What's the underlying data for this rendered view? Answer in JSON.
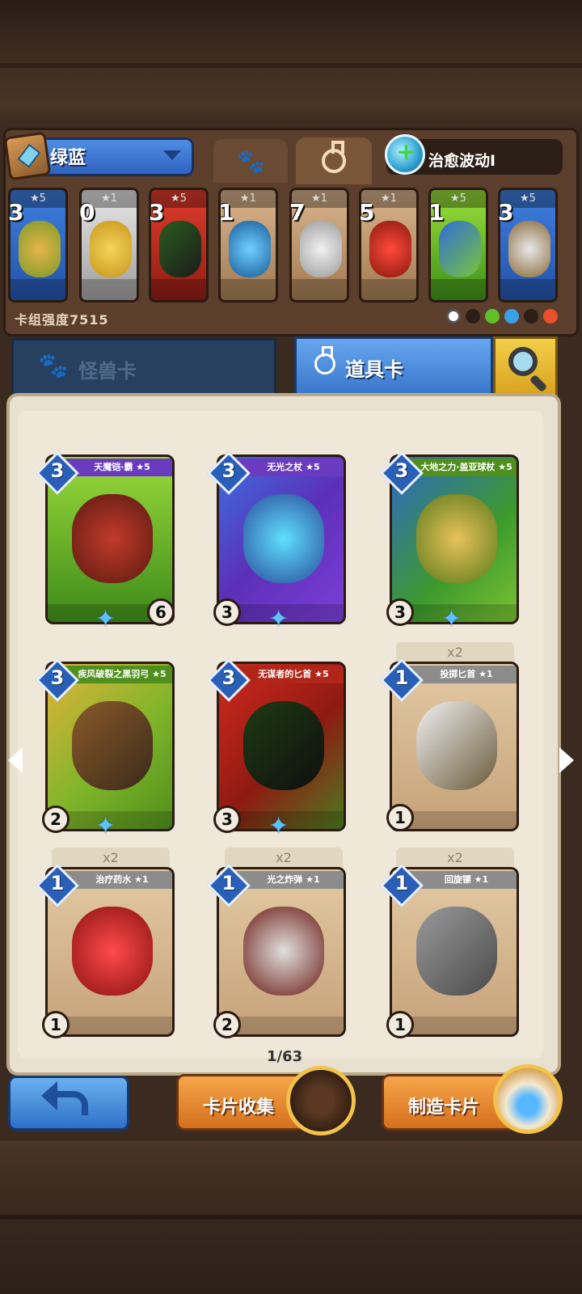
{
  "deck": {
    "name": "绿蓝",
    "power_label": "卡组强度7515",
    "skill_name": "治愈波动I",
    "cards": [
      {
        "cost": "3",
        "stars": "★5",
        "color": "c-blue"
      },
      {
        "cost": "0",
        "stars": "★1",
        "color": "c-white"
      },
      {
        "cost": "3",
        "stars": "★5",
        "color": "c-red"
      },
      {
        "cost": "1",
        "stars": "★1",
        "color": "c-tan"
      },
      {
        "cost": "7",
        "stars": "★1",
        "color": "c-tan"
      },
      {
        "cost": "5",
        "stars": "★1",
        "color": "c-tan"
      },
      {
        "cost": "1",
        "stars": "★5",
        "color": "c-green"
      },
      {
        "cost": "3",
        "stars": "★5",
        "color": "c-blue"
      }
    ]
  },
  "tabs": {
    "monster": "怪兽卡",
    "item": "道具卡"
  },
  "collection": {
    "cards": [
      {
        "name": "天魔铠·霸 ★5",
        "cost": "3",
        "stat_left": "",
        "stat_right": "6"
      },
      {
        "name": "无光之杖 ★5",
        "cost": "3",
        "stat_left": "3",
        "stat_right": ""
      },
      {
        "name": "大地之力·盖亚球杖 ★5",
        "cost": "3",
        "stat_left": "3",
        "stat_right": ""
      },
      {
        "name": "疾风破裂之黑羽弓 ★5",
        "cost": "3",
        "stat_left": "2",
        "stat_right": ""
      },
      {
        "name": "无谋者的匕首 ★5",
        "cost": "3",
        "stat_left": "3",
        "stat_right": ""
      },
      {
        "name": "投掷匕首 ★1",
        "cost": "1",
        "stat_left": "1",
        "stat_right": "",
        "dup": "x2"
      },
      {
        "name": "治疗药水 ★1",
        "cost": "1",
        "stat_left": "1",
        "stat_right": "",
        "dup": "x2"
      },
      {
        "name": "光之炸弹 ★1",
        "cost": "1",
        "stat_left": "2",
        "stat_right": "",
        "dup": "x2"
      },
      {
        "name": "回旋镖 ★1",
        "cost": "1",
        "stat_left": "1",
        "stat_right": "",
        "dup": "x2"
      }
    ],
    "page": "1/63"
  },
  "buttons": {
    "collect": "卡片收集",
    "craft": "制造卡片"
  },
  "colors": {
    "accent_blue": "#3b78cc",
    "accent_orange": "#d66f1d",
    "parchment": "#e9e1cf"
  }
}
